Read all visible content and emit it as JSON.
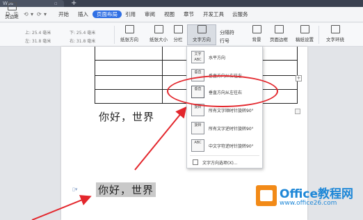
{
  "titlebar": {
    "tab_title": "Wps",
    "plus": "+"
  },
  "menubar": {
    "quick_icons": [
      "D",
      "⎘",
      "⟲",
      "▾",
      "⟳",
      "▾"
    ],
    "items": [
      "开始",
      "插入",
      "页面布局",
      "引用",
      "审阅",
      "视图",
      "章节",
      "开发工具",
      "云服务"
    ],
    "active": "页面布局"
  },
  "ribbon": {
    "left_label": "页边距",
    "margin_top": "上: 25.4 毫米",
    "margin_left": "左: 31.8 毫米",
    "margin_bottom": "下: 25.4 毫米",
    "margin_right": "右: 31.8 毫米",
    "buttons": [
      "纸张方向",
      "纸张大小",
      "分栏",
      "文字方向",
      "背景",
      "页面边框",
      "稿纸设置",
      "文字环绕"
    ],
    "small_buttons": [
      "分隔符",
      "行号"
    ]
  },
  "document": {
    "hello_text": "你好，世界",
    "hello_text_selected": "你好，世界"
  },
  "dropdown": {
    "items": [
      {
        "icon": "文字ABC",
        "label": "水平方向"
      },
      {
        "icon": "垂直",
        "label": "垂直方向从右往左"
      },
      {
        "icon": "垂直",
        "label": "垂直方向从左往右"
      },
      {
        "icon": "旋转",
        "label": "所有文字顺时针旋转90°"
      },
      {
        "icon": "旋转",
        "label": "所有文字逆时针旋转90°"
      },
      {
        "icon": "ABC",
        "label": "中文字符逆时针旋转90°"
      }
    ],
    "options_label": "文字方向选项(X)..."
  },
  "watermark": {
    "title": "Office教程网",
    "url": "www.office26.com"
  },
  "colors": {
    "accent": "#2f6fe4",
    "annotation": "#e3262c",
    "watermark": "#1e87d7",
    "logo": "#f28a17"
  }
}
